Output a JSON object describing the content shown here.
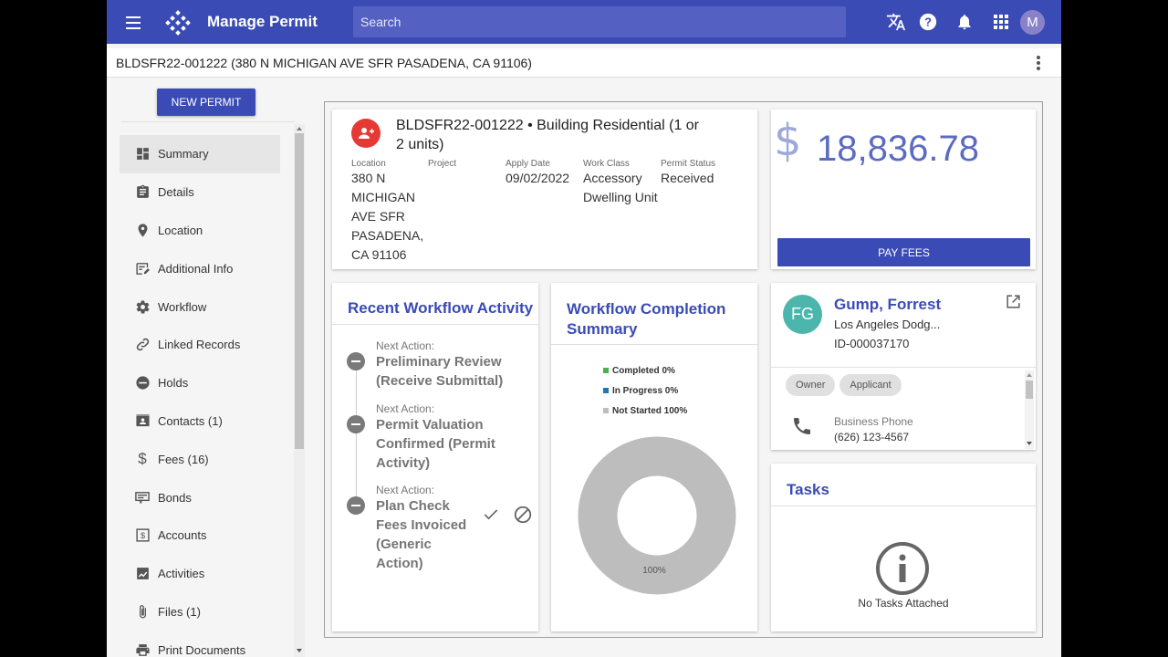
{
  "app": {
    "title": "Manage Permit",
    "search_placeholder": "Search",
    "user_initial": "M",
    "brand_color": "#3a4bb5"
  },
  "record_bar": {
    "title": "BLDSFR22-001222 (380 N MICHIGAN AVE SFR PASADENA, CA 91106)"
  },
  "sidebar": {
    "new_permit_label": "NEW PERMIT",
    "items": [
      {
        "label": "Summary",
        "icon": "dashboard-icon",
        "active": true
      },
      {
        "label": "Details",
        "icon": "clipboard-icon"
      },
      {
        "label": "Location",
        "icon": "location-pin-icon"
      },
      {
        "label": "Additional Info",
        "icon": "edit-form-icon"
      },
      {
        "label": "Workflow",
        "icon": "gear-icon"
      },
      {
        "label": "Linked Records",
        "icon": "link-icon"
      },
      {
        "label": "Holds",
        "icon": "minus-circle-icon"
      },
      {
        "label": "Contacts (1)",
        "icon": "contact-card-icon"
      },
      {
        "label": "Fees (16)",
        "icon": "dollar-icon"
      },
      {
        "label": "Bonds",
        "icon": "bond-icon"
      },
      {
        "label": "Accounts",
        "icon": "accounts-icon"
      },
      {
        "label": "Activities",
        "icon": "activities-icon"
      },
      {
        "label": "Files (1)",
        "icon": "paperclip-icon"
      },
      {
        "label": "Print Documents",
        "icon": "printer-icon"
      }
    ]
  },
  "permit": {
    "title": "BLDSFR22-001222 • Building Residential (1 or 2 units)",
    "title_line1": "BLDSFR22-001222 • Building Residential (1 or",
    "title_line2": "2 units)",
    "location_label": "Location",
    "location_lines": [
      "380 N",
      "MICHIGAN",
      "AVE SFR",
      "PASADENA,",
      "CA 91106"
    ],
    "project_label": "Project",
    "apply_date_label": "Apply Date",
    "apply_date": "09/02/2022",
    "work_class_label": "Work Class",
    "work_class_lines": [
      "Accessory",
      "Dwelling Unit"
    ],
    "status_label": "Permit Status",
    "status": "Received",
    "icon": "people-badge-icon",
    "icon_color": "#e53935"
  },
  "fees": {
    "currency_symbol": "$",
    "amount": "18,836.78",
    "pay_label": "PAY FEES"
  },
  "recent_workflow": {
    "title": "Recent Workflow Activity",
    "steps": [
      {
        "label": "Next Action:",
        "lines": [
          "Preliminary Review",
          "(Receive Submittal)"
        ]
      },
      {
        "label": "Next Action:",
        "lines": [
          "Permit Valuation",
          "Confirmed (Permit",
          "Activity)"
        ]
      },
      {
        "label": "Next Action:",
        "lines": [
          "Plan Check",
          "Fees Invoiced",
          "(Generic",
          "Action)"
        ]
      }
    ]
  },
  "completion": {
    "title_lines": [
      "Workflow Completion",
      "Summary"
    ],
    "legend": [
      {
        "label": "Completed 0%",
        "color": "#4caf50"
      },
      {
        "label": "In Progress 0%",
        "color": "#1f77b4"
      },
      {
        "label": "Not Started 100%",
        "color": "#bdbdbd"
      }
    ],
    "center_label": "100%"
  },
  "chart_data": {
    "type": "pie",
    "categories": [
      "Completed",
      "In Progress",
      "Not Started"
    ],
    "values": [
      0,
      0,
      100
    ],
    "legend_position": "top"
  },
  "contact": {
    "initials": "FG",
    "avatar_color": "#4db6ac",
    "name": "Gump, Forrest",
    "company": "Los Angeles Dodg...",
    "id": "ID-000037170",
    "roles": [
      "Owner",
      "Applicant"
    ],
    "phone_label": "Business Phone",
    "phone": "(626) 123-4567"
  },
  "tasks": {
    "title": "Tasks",
    "empty_label": "No Tasks Attached"
  }
}
